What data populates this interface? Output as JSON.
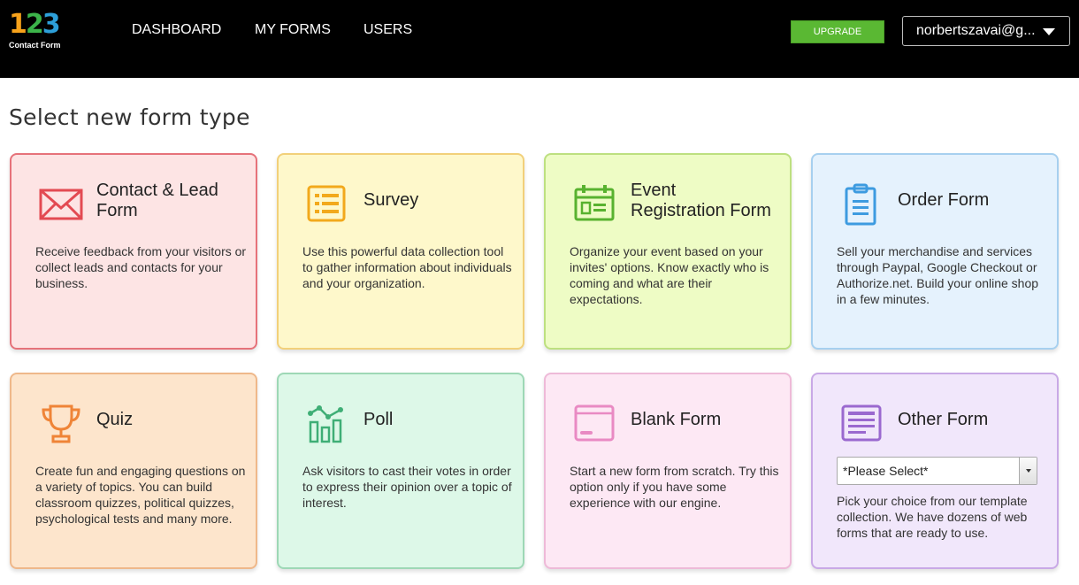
{
  "header": {
    "logo_digits": [
      "1",
      "2",
      "3"
    ],
    "logo_subtitle": "Contact Form",
    "nav": [
      "DASHBOARD",
      "MY FORMS",
      "USERS"
    ],
    "upgrade_label": "UPGRADE",
    "user_email": "norbertszavai@g..."
  },
  "page_title": "Select new form type",
  "cards": [
    {
      "title": "Contact & Lead Form",
      "title_l1": "Contact & Lead",
      "title_l2": "Form",
      "icon": "envelope-icon",
      "color": "#e34a52",
      "description": "Receive feedback from your visitors or collect leads and contacts for your business."
    },
    {
      "title": "Survey",
      "icon": "list-icon",
      "color": "#f2a91c",
      "description": "Use this powerful data collection tool to gather information about individuals and your organization."
    },
    {
      "title": "Event Registration Form",
      "title_l1": "Event",
      "title_l2": "Registration Form",
      "icon": "calendar-icon",
      "color": "#58b22f",
      "description": "Organize your event based on your invites' options. Know exactly who is coming and what are their expectations."
    },
    {
      "title": "Order Form",
      "icon": "clipboard-icon",
      "color": "#3d9be0",
      "description": "Sell your merchandise and services through Paypal, Google Checkout or Authorize.net. Build your online shop in a few minutes."
    },
    {
      "title": "Quiz",
      "icon": "trophy-icon",
      "color": "#ef8437",
      "description": "Create fun and engaging questions on a variety of topics. You can build classroom quizzes, political quizzes, psychological tests and many more."
    },
    {
      "title": "Poll",
      "icon": "bar-chart-icon",
      "color": "#3fae76",
      "description": "Ask visitors to cast their votes in order to express their opinion over a topic of interest."
    },
    {
      "title": "Blank Form",
      "icon": "blank-window-icon",
      "color": "#e98ac3",
      "description": "Start a new form from scratch. Try this option only if you have some experience with our engine."
    },
    {
      "title": "Other Form",
      "icon": "form-lines-icon",
      "color": "#9a69cf",
      "select_value": "*Please Select*",
      "description": "Pick your choice from our template collection. We have dozens of web forms that are ready to use."
    }
  ]
}
